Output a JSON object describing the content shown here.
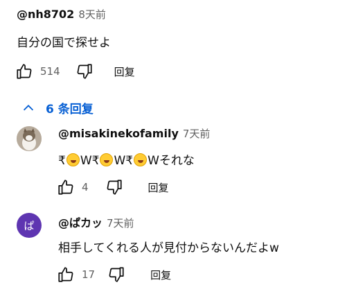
{
  "comment": {
    "author": "@nh8702",
    "time": "8天前",
    "text": "自分の国で探せよ",
    "likes": "514",
    "reply_label": "回复"
  },
  "replies_toggle": {
    "label": "6 条回复",
    "icon": "chevron-up-icon"
  },
  "replies": [
    {
      "author": "@misakinekofamily",
      "time": "7天前",
      "text_parts": [
        "₹",
        "W₹",
        "W₹",
        "Wそれな"
      ],
      "emoji": "rolling-on-floor-laughing",
      "likes": "4",
      "reply_label": "回复"
    },
    {
      "author": "@ぱカッ",
      "time": "7天前",
      "avatar_letter": "ぱ",
      "avatar_color": "#5e35b1",
      "text": "相手してくれる人が見付からないんだよw",
      "likes": "17",
      "reply_label": "回复"
    }
  ],
  "colors": {
    "link": "#065fd4",
    "secondary": "#606060",
    "text": "#0f0f0f"
  }
}
